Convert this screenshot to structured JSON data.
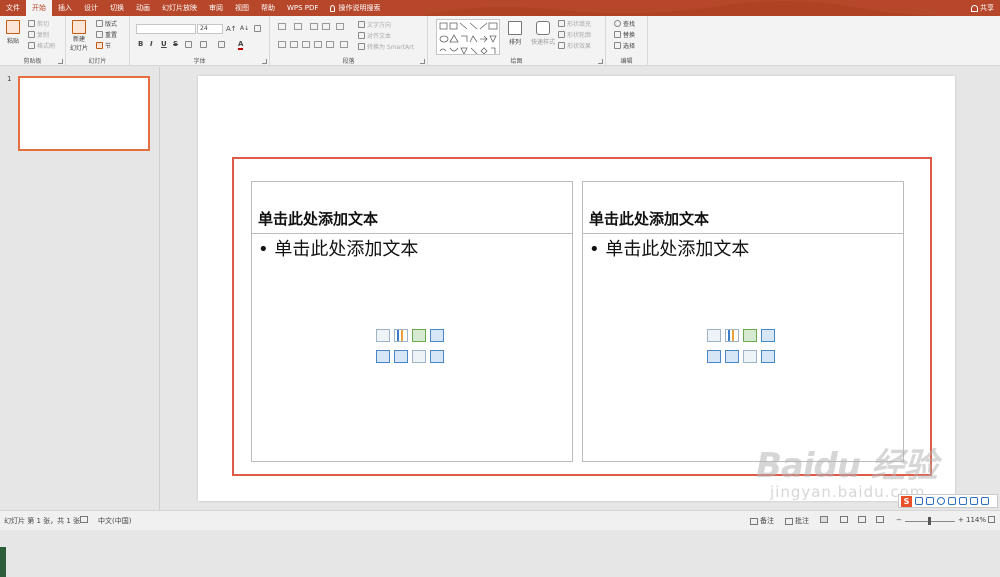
{
  "tabs": [
    {
      "label": "文件",
      "active": false
    },
    {
      "label": "开始",
      "active": true
    },
    {
      "label": "插入",
      "active": false
    },
    {
      "label": "设计",
      "active": false
    },
    {
      "label": "切换",
      "active": false
    },
    {
      "label": "动画",
      "active": false
    },
    {
      "label": "幻灯片放映",
      "active": false
    },
    {
      "label": "审阅",
      "active": false
    },
    {
      "label": "视图",
      "active": false
    },
    {
      "label": "帮助",
      "active": false
    },
    {
      "label": "WPS PDF",
      "active": false
    }
  ],
  "tell_me": "操作说明搜索",
  "share_label": "共享",
  "ribbon": {
    "clipboard": {
      "label": "剪贴板",
      "paste": "粘贴",
      "cut": "剪切",
      "copy": "复制",
      "format_painter": "格式刷"
    },
    "slides": {
      "label": "幻灯片",
      "new_slide": "新建",
      "new_slide_2": "幻灯片",
      "layout": "版式",
      "reset": "重置",
      "section": "节"
    },
    "font": {
      "label": "字体",
      "font_name": "",
      "font_size": "24",
      "bold": "B",
      "italic": "I",
      "underline": "U",
      "strike": "S",
      "font_color": "A"
    },
    "paragraph": {
      "label": "段落",
      "text_direction": "文字方向",
      "align_text": "对齐文本",
      "smartart": "转换为 SmartArt"
    },
    "drawing": {
      "label": "绘图",
      "arrange": "排列",
      "quick_styles": "快速样式",
      "shape_fill": "形状填充",
      "shape_outline": "形状轮廓",
      "shape_effects": "形状效果"
    },
    "editing": {
      "label": "编辑",
      "find": "查找",
      "replace": "替换",
      "select": "选择"
    }
  },
  "thumbnails": [
    {
      "number": "1"
    }
  ],
  "slide": {
    "left": {
      "title": "单击此处添加文本",
      "body": "• 单击此处添加文本"
    },
    "right": {
      "title": "单击此处添加文本",
      "body": "• 单击此处添加文本"
    }
  },
  "status": {
    "slide_info": "幻灯片 第 1 张，共 1 张",
    "language": "中文(中国)",
    "notes": "备注",
    "comments": "批注",
    "zoom": "114%"
  },
  "watermark": {
    "line1": "Baidu 经验",
    "line2": "jingyan.baidu.com"
  },
  "colors": {
    "accent": "#b7472a",
    "selection": "#e05a4a",
    "thumb_border": "#e4703f"
  }
}
